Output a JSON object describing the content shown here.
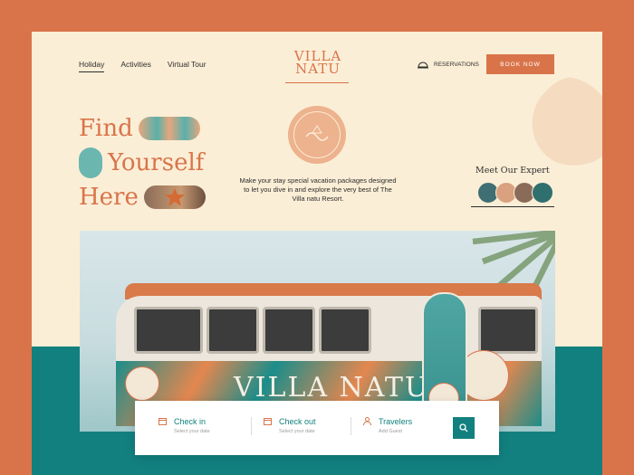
{
  "nav": {
    "items": [
      {
        "label": "Holiday"
      },
      {
        "label": "Activities"
      },
      {
        "label": "Virtual Tour"
      }
    ]
  },
  "logo": {
    "line1": "VILLA",
    "line2": "NATU"
  },
  "header": {
    "reservations": "RESERVATIONS",
    "book_now": "BOOK NOW"
  },
  "hero": {
    "line1": "Find",
    "line2": "Yourself",
    "line3": "Here",
    "emblem_text": "VILLA NATU",
    "tagline": "Make your stay special vacation packages designed to let you dive in and explore the very best of  The Villa natu Resort."
  },
  "expert": {
    "title": "Meet Our Expert"
  },
  "photo": {
    "van_text": "VILLA NATU",
    "badge_text": "VILLA NATU"
  },
  "search": {
    "checkin": {
      "label": "Check in",
      "sub": "Select your date"
    },
    "checkout": {
      "label": "Check out",
      "sub": "Select your date"
    },
    "travelers": {
      "label": "Travelers",
      "sub": "Add Guest"
    }
  },
  "colors": {
    "accent": "#d9744a",
    "teal": "#12807f",
    "cream": "#fbeed6"
  }
}
